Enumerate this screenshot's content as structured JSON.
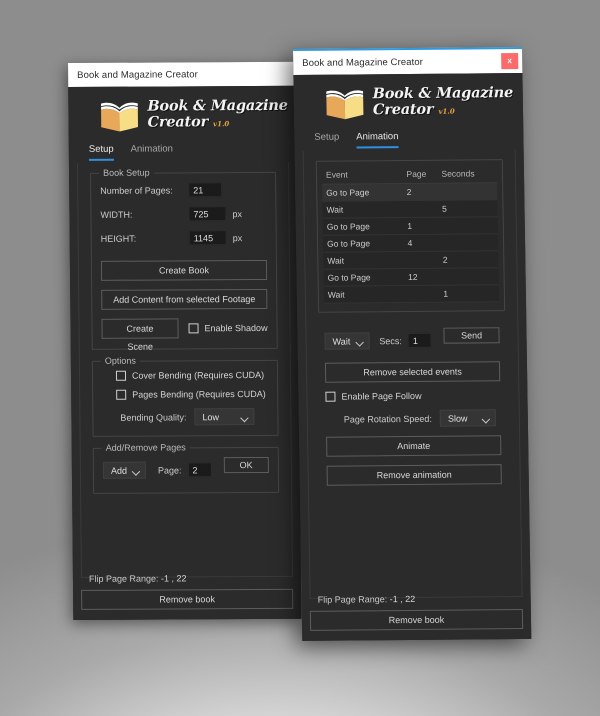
{
  "window_left": {
    "title": "Book and Magazine Creator",
    "logo": {
      "line1": "Book & Magazine",
      "line2": "Creator",
      "version": "v1.0"
    },
    "tabs": [
      {
        "label": "Setup",
        "active": true
      },
      {
        "label": "Animation",
        "active": false
      }
    ],
    "book_setup": {
      "legend": "Book Setup",
      "pages_label": "Number of Pages:",
      "pages_value": "21",
      "width_label": "WIDTH:",
      "width_value": "725",
      "width_unit": "px",
      "height_label": "HEIGHT:",
      "height_value": "1145",
      "height_unit": "px",
      "create_book": "Create Book",
      "add_content": "Add Content from selected Footage",
      "create_scene": "Create Scene",
      "enable_shadow": "Enable Shadow",
      "enable_shadow_checked": false
    },
    "options": {
      "legend": "Options",
      "cover_bending": "Cover Bending (Requires CUDA)",
      "cover_bending_checked": false,
      "pages_bending": "Pages Bending (Requires CUDA)",
      "pages_bending_checked": false,
      "bending_quality_label": "Bending Quality:",
      "bending_quality_value": "Low"
    },
    "add_remove": {
      "legend": "Add/Remove Pages",
      "action_value": "Add",
      "page_label": "Page:",
      "page_value": "2",
      "ok_label": "OK"
    },
    "footer": {
      "flip_label": "Flip Page Range:",
      "flip_value": "-1 , 22",
      "remove_book": "Remove book"
    }
  },
  "window_right": {
    "title": "Book and Magazine Creator",
    "close_label": "x",
    "logo": {
      "line1": "Book & Magazine",
      "line2": "Creator",
      "version": "v1.0"
    },
    "tabs": [
      {
        "label": "Setup",
        "active": false
      },
      {
        "label": "Animation",
        "active": true
      }
    ],
    "event_table": {
      "headers": [
        "Event",
        "Page",
        "Seconds"
      ],
      "rows": [
        {
          "event": "Go to Page",
          "page": "2",
          "seconds": "",
          "selected": true
        },
        {
          "event": "Wait",
          "page": "",
          "seconds": "5",
          "selected": false
        },
        {
          "event": "Go to Page",
          "page": "1",
          "seconds": "",
          "selected": false
        },
        {
          "event": "Go to Page",
          "page": "4",
          "seconds": "",
          "selected": false
        },
        {
          "event": "Wait",
          "page": "",
          "seconds": "2",
          "selected": false
        },
        {
          "event": "Go to Page",
          "page": "12",
          "seconds": "",
          "selected": false
        },
        {
          "event": "Wait",
          "page": "",
          "seconds": "1",
          "selected": false
        }
      ]
    },
    "controls": {
      "event_type_value": "Wait",
      "secs_label": "Secs:",
      "secs_value": "1",
      "send_label": "Send",
      "remove_selected": "Remove selected events",
      "enable_page_follow": "Enable Page Follow",
      "enable_page_follow_checked": false,
      "rotation_speed_label": "Page Rotation Speed:",
      "rotation_speed_value": "Slow",
      "animate": "Animate",
      "remove_animation": "Remove animation"
    },
    "footer": {
      "flip_label": "Flip Page Range:",
      "flip_value": "-1 , 22",
      "remove_book": "Remove book"
    }
  },
  "colors": {
    "accent_blue": "#2f8fe0",
    "close_red": "#fb6b6b",
    "logo_orange": "#e8a33d",
    "panel_bg": "#2b2b2b"
  }
}
